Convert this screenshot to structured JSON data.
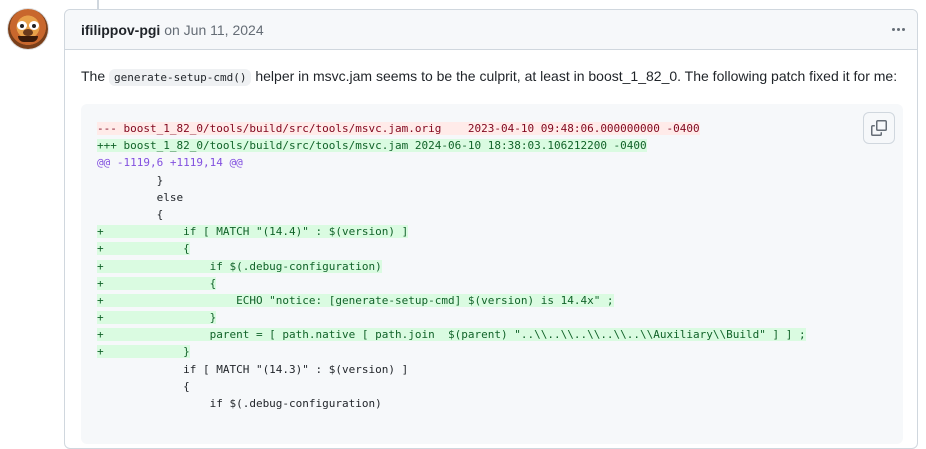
{
  "comment": {
    "author": "ifilippov-pgi",
    "date_text": "on Jun 11, 2024",
    "body": {
      "prefix": "The ",
      "code": "generate-setup-cmd()",
      "suffix": " helper in msvc.jam seems to be the culprit, at least in boost_1_82_0. The following patch fixed it for me:"
    },
    "code_lines": [
      {
        "type": "del",
        "text": "--- boost_1_82_0/tools/build/src/tools/msvc.jam.orig    2023-04-10 09:48:06.000000000 -0400"
      },
      {
        "type": "add",
        "text": "+++ boost_1_82_0/tools/build/src/tools/msvc.jam 2024-06-10 18:38:03.106212200 -0400"
      },
      {
        "type": "hunk",
        "text": "@@ -1119,6 +1119,14 @@"
      },
      {
        "type": "ctx",
        "text": "         }"
      },
      {
        "type": "ctx",
        "text": "         else"
      },
      {
        "type": "ctx",
        "text": "         {"
      },
      {
        "type": "add",
        "text": "+            if [ MATCH \"(14.4)\" : $(version) ]"
      },
      {
        "type": "add",
        "text": "+            {"
      },
      {
        "type": "add",
        "text": "+                if $(.debug-configuration)"
      },
      {
        "type": "add",
        "text": "+                {"
      },
      {
        "type": "add",
        "text": "+                    ECHO \"notice: [generate-setup-cmd] $(version) is 14.4x\" ;"
      },
      {
        "type": "add",
        "text": "+                }"
      },
      {
        "type": "add",
        "text": "+                parent = [ path.native [ path.join  $(parent) \"..\\\\..\\\\..\\\\..\\\\..\\\\Auxiliary\\\\Build\" ] ] ;"
      },
      {
        "type": "add",
        "text": "+            }"
      },
      {
        "type": "ctx",
        "text": "             if [ MATCH \"(14.3)\" : $(version) ]"
      },
      {
        "type": "ctx",
        "text": "             {"
      },
      {
        "type": "ctx",
        "text": "                 if $(.debug-configuration)"
      }
    ]
  },
  "icons": {
    "menu": "kebab-horizontal-icon",
    "copy": "copy-icon"
  },
  "colors": {
    "del_bg": "#ffebe9",
    "add_bg": "#dafbe1",
    "hunk_fg": "#8250df"
  }
}
